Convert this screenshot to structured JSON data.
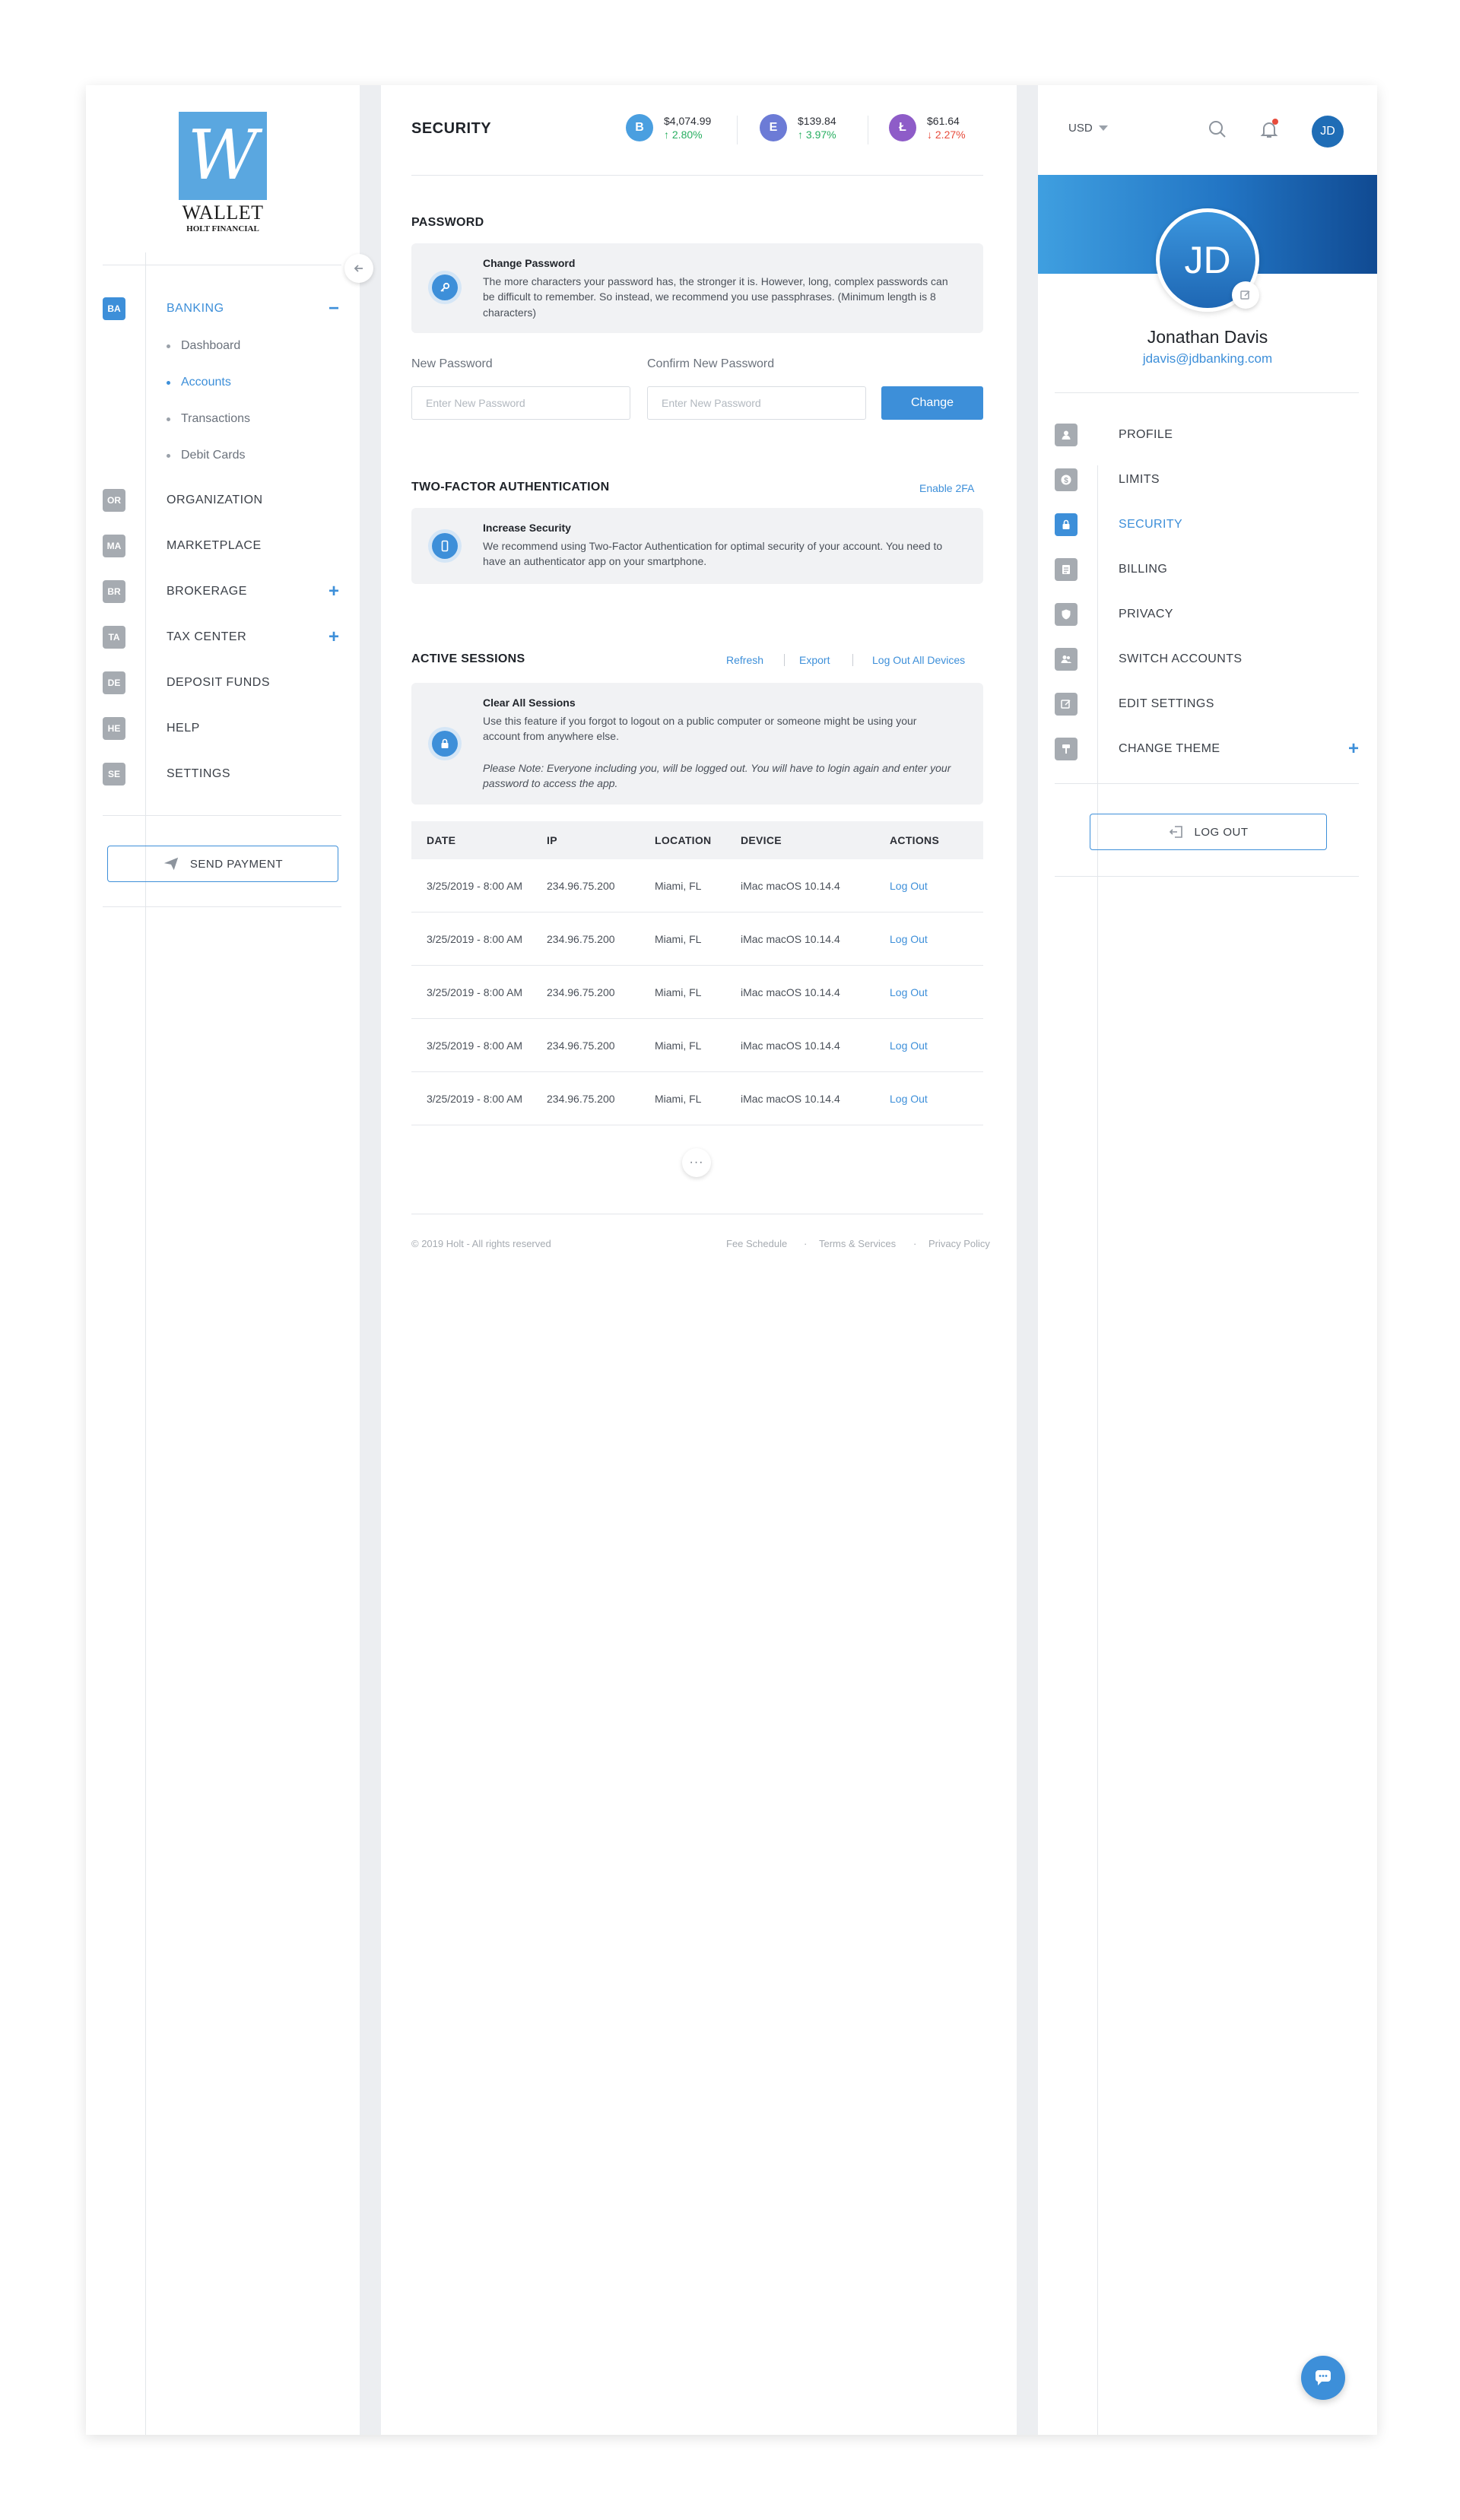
{
  "brand": {
    "logo_letter": "W",
    "name": "WALLET",
    "sub": "HOLT FINANCIAL"
  },
  "sidebar": {
    "items": [
      {
        "badge": "BA",
        "label": "BANKING",
        "toggle": "−",
        "active": true
      },
      {
        "badge": "OR",
        "label": "ORGANIZATION",
        "toggle": ""
      },
      {
        "badge": "MA",
        "label": "MARKETPLACE",
        "toggle": ""
      },
      {
        "badge": "BR",
        "label": "BROKERAGE",
        "toggle": "+"
      },
      {
        "badge": "TA",
        "label": "TAX CENTER",
        "toggle": "+"
      },
      {
        "badge": "DE",
        "label": "DEPOSIT FUNDS",
        "toggle": ""
      },
      {
        "badge": "HE",
        "label": "HELP",
        "toggle": ""
      },
      {
        "badge": "SE",
        "label": "SETTINGS",
        "toggle": ""
      }
    ],
    "banking_sub": [
      "Dashboard",
      "Accounts",
      "Transactions",
      "Debit Cards"
    ],
    "active_sub": "Accounts",
    "send_payment": "SEND PAYMENT"
  },
  "header": {
    "title": "SECURITY",
    "tickers": [
      {
        "symbol": "B",
        "price": "$4,074.99",
        "change": "↑ 2.80%",
        "direction": "up",
        "color": "#4a9fe0"
      },
      {
        "symbol": "E",
        "price": "$139.84",
        "change": "↑ 3.97%",
        "direction": "up",
        "color": "#6c7bd6"
      },
      {
        "symbol": "Ł",
        "price": "$61.64",
        "change": "↓ 2.27%",
        "direction": "down",
        "color": "#8e5cc8"
      }
    ]
  },
  "password": {
    "heading": "PASSWORD",
    "info_title": "Change Password",
    "info_text": "The more characters your password has, the stronger it is. However, long, complex passwords can be difficult to remember. So instead, we recommend you use passphrases. (Minimum length is 8 characters)",
    "new_label": "New Password",
    "confirm_label": "Confirm New Password",
    "placeholder": "Enter New Password",
    "button": "Change"
  },
  "twofa": {
    "heading": "TWO-FACTOR AUTHENTICATION",
    "enable_link": "Enable 2FA",
    "info_title": "Increase Security",
    "info_text": "We recommend using Two-Factor Authentication for optimal security of your account. You need to have an authenticator app on your smartphone."
  },
  "sessions": {
    "heading": "ACTIVE SESSIONS",
    "links": {
      "refresh": "Refresh",
      "export": "Export",
      "logout_all": "Log Out All Devices"
    },
    "info_title": "Clear All Sessions",
    "info_text": "Use this feature if you forgot to logout on a public computer or someone might be using your account from anywhere else.",
    "info_note": "Please Note: Everyone including you, will be logged out. You will have to login again and enter your password to access the app.",
    "columns": [
      "DATE",
      "IP",
      "LOCATION",
      "DEVICE",
      "ACTIONS"
    ],
    "rows": [
      [
        "3/25/2019 - 8:00 AM",
        "234.96.75.200",
        "Miami, FL",
        "iMac macOS 10.14.4",
        "Log Out"
      ],
      [
        "3/25/2019 - 8:00 AM",
        "234.96.75.200",
        "Miami, FL",
        "iMac macOS 10.14.4",
        "Log Out"
      ],
      [
        "3/25/2019 - 8:00 AM",
        "234.96.75.200",
        "Miami, FL",
        "iMac macOS 10.14.4",
        "Log Out"
      ],
      [
        "3/25/2019 - 8:00 AM",
        "234.96.75.200",
        "Miami, FL",
        "iMac macOS 10.14.4",
        "Log Out"
      ],
      [
        "3/25/2019 - 8:00 AM",
        "234.96.75.200",
        "Miami, FL",
        "iMac macOS 10.14.4",
        "Log Out"
      ]
    ],
    "more": "···"
  },
  "footer": {
    "copyright": "© 2019 Holt - All rights reserved",
    "links": [
      "Fee Schedule",
      "Terms & Services",
      "Privacy Policy"
    ],
    "sep": "·"
  },
  "account": {
    "currency": "USD",
    "initials": "JD",
    "name": "Jonathan Davis",
    "email": "jdavis@jdbanking.com",
    "menu": [
      {
        "icon": "user-icon",
        "label": "PROFILE"
      },
      {
        "icon": "dollar-icon",
        "label": "LIMITS"
      },
      {
        "icon": "lock-icon",
        "label": "SECURITY",
        "active": true
      },
      {
        "icon": "billing-icon",
        "label": "BILLING"
      },
      {
        "icon": "shield-icon",
        "label": "PRIVACY"
      },
      {
        "icon": "users-icon",
        "label": "SWITCH ACCOUNTS"
      },
      {
        "icon": "edit-icon",
        "label": "EDIT SETTINGS"
      },
      {
        "icon": "paint-roller-icon",
        "label": "CHANGE THEME",
        "toggle": "+"
      }
    ],
    "logout": "LOG OUT"
  },
  "colors": {
    "accent": "#3d8fd9",
    "up": "#27ae60",
    "down": "#e74c3c"
  }
}
